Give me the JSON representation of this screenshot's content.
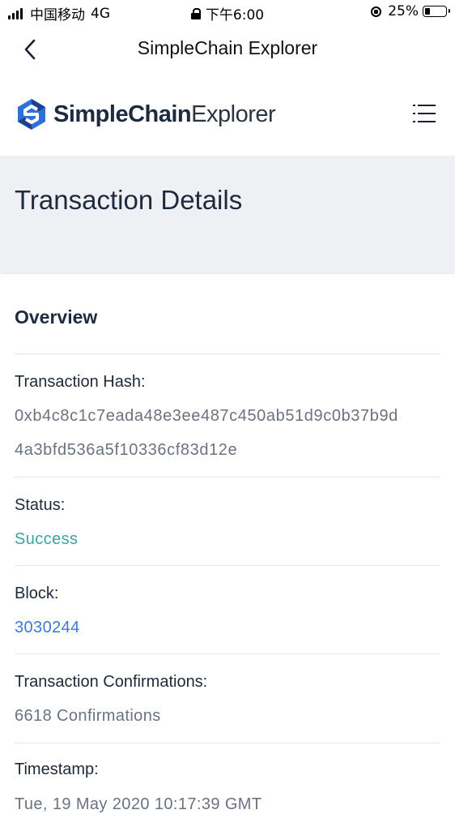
{
  "status_bar": {
    "carrier": "中国移动",
    "network": "4G",
    "time": "下午6:00",
    "battery": "25%",
    "battery_level": 0.25
  },
  "nav": {
    "title": "SimpleChain Explorer",
    "back_icon": "chevron-left-icon"
  },
  "header": {
    "logo_strong": "SimpleChain",
    "logo_light": "Explorer",
    "menu_icon": "hamburger-menu-icon"
  },
  "page": {
    "title": "Transaction Details"
  },
  "overview": {
    "heading": "Overview",
    "fields": {
      "hash": {
        "label": "Transaction Hash:",
        "value_line1": "0xb4c8c1c7eada48e3ee487c450ab51d9c0b37b9d",
        "value_line2": "4a3bfd536a5f10336cf83d12e"
      },
      "status": {
        "label": "Status:",
        "value": "Success"
      },
      "block": {
        "label": "Block:",
        "value": "3030244"
      },
      "confirmations": {
        "label": "Transaction Confirmations:",
        "value": "6618 Confirmations"
      },
      "timestamp": {
        "label": "Timestamp:",
        "value": "Tue, 19 May 2020 10:17:39 GMT"
      }
    }
  },
  "colors": {
    "success": "#3aa6a0",
    "link": "#3f77d6",
    "banner_bg": "#eef0f3",
    "title_text": "#1e2a3d"
  }
}
